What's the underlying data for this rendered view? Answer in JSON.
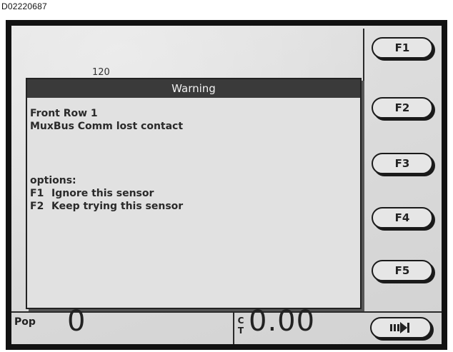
{
  "document_id": "D02220687",
  "background_value": "120",
  "warning": {
    "title": "Warning",
    "lines": [
      "Front Row 1",
      "MuxBus Comm lost contact"
    ],
    "options_header": "options:",
    "options": [
      {
        "key": "F1",
        "label": "Ignore this sensor"
      },
      {
        "key": "F2",
        "label": "Keep trying this sensor"
      }
    ]
  },
  "function_keys": [
    "F1",
    "F2",
    "F3",
    "F4",
    "F5"
  ],
  "status_bar": {
    "pop_label": "Pop",
    "pop_value": "0",
    "ct_label_top": "C",
    "ct_label_bottom": "T",
    "ct_value": "0.00"
  },
  "nav_key_icon": "page-arrow-icon",
  "colors": {
    "screen_bg": "#dcdcdc",
    "title_bar": "#3a3a3a",
    "title_text": "#f2f2f2",
    "text": "#2a2a2a",
    "bezel": "#111111"
  }
}
